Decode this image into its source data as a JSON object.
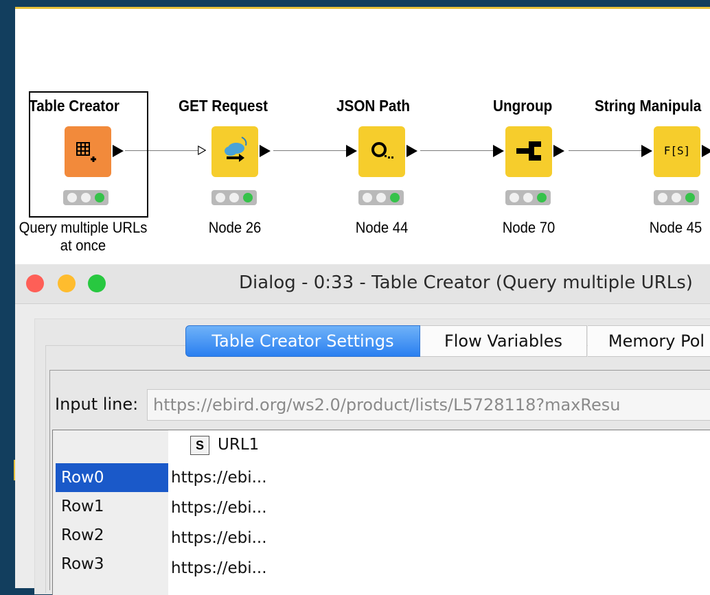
{
  "workflow": {
    "nodes": [
      {
        "title": "Table Creator",
        "label_line1": "Query multiple URLs",
        "label_line2": "at once",
        "icon": "table-plus-icon",
        "color": "#f28a3b"
      },
      {
        "title": "GET Request",
        "label_line1": "Node 26",
        "icon": "cloud-arrow-icon",
        "color": "#f6cd2c"
      },
      {
        "title": "JSON Path",
        "label_line1": "Node 44",
        "icon": "json-path-icon",
        "color": "#f6cd2c"
      },
      {
        "title": "Ungroup",
        "label_line1": "Node 70",
        "icon": "ungroup-icon",
        "color": "#f6cd2c"
      },
      {
        "title": "String Manipula",
        "label_line1": "Node 45",
        "icon": "string-manipulation-icon",
        "icon_text": "F[S]",
        "color": "#f6cd2c"
      }
    ]
  },
  "dialog": {
    "title": "Dialog - 0:33 - Table Creator (Query multiple URLs)",
    "tabs": [
      "Table Creator Settings",
      "Flow Variables",
      "Memory Pol"
    ],
    "input_label": "Input line:",
    "input_value": "https://ebird.org/ws2.0/product/lists/L5728118?maxResu",
    "column": {
      "type": "S",
      "name": "URL1"
    },
    "rows": [
      {
        "label": "Row0",
        "value": "https://ebi..."
      },
      {
        "label": "Row1",
        "value": "https://ebi..."
      },
      {
        "label": "Row2",
        "value": "https://ebi..."
      },
      {
        "label": "Row3",
        "value": "https://ebi..."
      }
    ],
    "window_controls": {
      "close": "#fe5f57",
      "minimize": "#febc2e",
      "zoom": "#28c840"
    }
  }
}
